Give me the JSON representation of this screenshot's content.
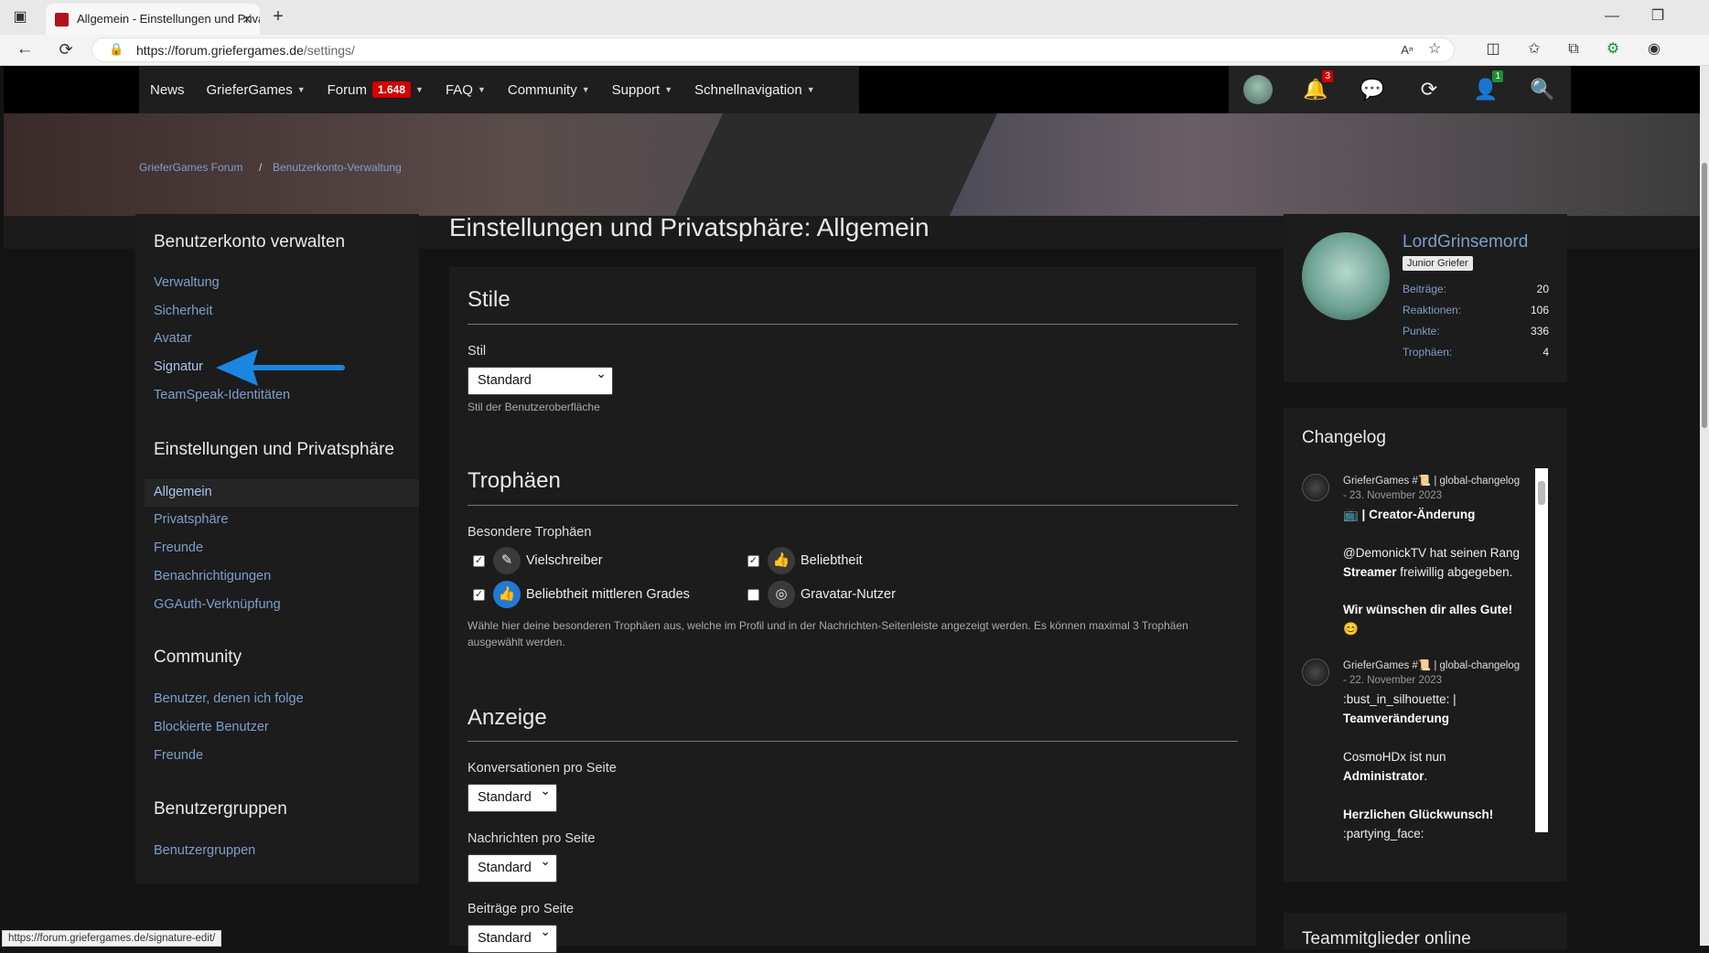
{
  "browser": {
    "tab_title": "Allgemein - Einstellungen und Privatsphäre",
    "url_domain": "https://forum.griefergames.de",
    "url_path": "/settings/",
    "status_url": "https://forum.griefergames.de/signature-edit/"
  },
  "nav": {
    "items": [
      "News",
      "GrieferGames",
      "Forum",
      "FAQ",
      "Community",
      "Support",
      "Schnellnavigation"
    ],
    "forum_badge": "1.648",
    "notifications_count": "3",
    "user_count": "1"
  },
  "breadcrumb": {
    "home": "GrieferGames Forum",
    "sep": "/",
    "current": "Benutzerkonto-Verwaltung"
  },
  "sidebar": {
    "h1": "Benutzerkonto verwalten",
    "account_links": [
      "Verwaltung",
      "Sicherheit",
      "Avatar",
      "Signatur",
      "TeamSpeak-Identitäten"
    ],
    "h2": "Einstellungen und Privatsphäre",
    "settings_links": [
      "Allgemein",
      "Privatsphäre",
      "Freunde",
      "Benachrichtigungen",
      "GGAuth-Verknüpfung"
    ],
    "h3": "Community",
    "community_links": [
      "Benutzer, denen ich folge",
      "Blockierte Benutzer",
      "Freunde"
    ],
    "h4": "Benutzergruppen",
    "group_links": [
      "Benutzergruppen"
    ]
  },
  "page": {
    "title": "Einstellungen und Privatsphäre: Allgemein",
    "style_section": "Stile",
    "style_label": "Stil",
    "style_value": "Standard",
    "style_hint": "Stil der Benutzeroberfläche",
    "trophy_section": "Trophäen",
    "trophy_label": "Besondere Trophäen",
    "trophies": [
      {
        "name": "Vielschreiber",
        "checked": true
      },
      {
        "name": "Beliebtheit",
        "checked": true
      },
      {
        "name": "Beliebtheit mittleren Grades",
        "checked": true
      },
      {
        "name": "Gravatar-Nutzer",
        "checked": false
      }
    ],
    "trophy_hint": "Wähle hier deine besonderen Trophäen aus, welche im Profil und in der Nachrichten-Seitenleiste angezeigt werden. Es können maximal 3 Trophäen ausgewählt werden.",
    "display_section": "Anzeige",
    "conv_label": "Konversationen pro Seite",
    "conv_value": "Standard",
    "msg_label": "Nachrichten pro Seite",
    "msg_value": "Standard",
    "posts_label": "Beiträge pro Seite",
    "posts_value": "Standard"
  },
  "profile": {
    "name": "LordGrinsemord",
    "rank": "Junior Griefer",
    "stats": [
      {
        "k": "Beiträge:",
        "v": "20"
      },
      {
        "k": "Reaktionen:",
        "v": "106"
      },
      {
        "k": "Punkte:",
        "v": "336"
      },
      {
        "k": "Trophäen:",
        "v": "4"
      }
    ]
  },
  "changelog": {
    "title": "Changelog",
    "e1_head": "GrieferGames #📜 | global-changelog",
    "e1_date": "- 23. November 2023",
    "e1_title": "📺 | Creator-Änderung",
    "e1_line1a": "@DemonickTV hat seinen Rang",
    "e1_line1b": "Streamer",
    "e1_line1c": " freiwillig abgegeben.",
    "e1_line2": "Wir wünschen dir alles Gute!",
    "e1_emoji": "😊",
    "e2_head": "GrieferGames #📜 | global-changelog",
    "e2_date": "- 22. November 2023",
    "e2_line0": ":bust_in_silhouette: |",
    "e2_title": "Teamveränderung",
    "e2_line1a": "CosmoHDx ist nun",
    "e2_line1b": "Administrator",
    "e2_line1c": ".",
    "e2_line2": "Herzlichen Glückwunsch!",
    "e2_line3": ":partying_face:"
  },
  "team_title": "Teammitglieder online",
  "colors": {
    "link": "#7e9ecb",
    "panel": "#1c1c1c",
    "badge": "#d10000",
    "arrow": "#1a86e0"
  }
}
